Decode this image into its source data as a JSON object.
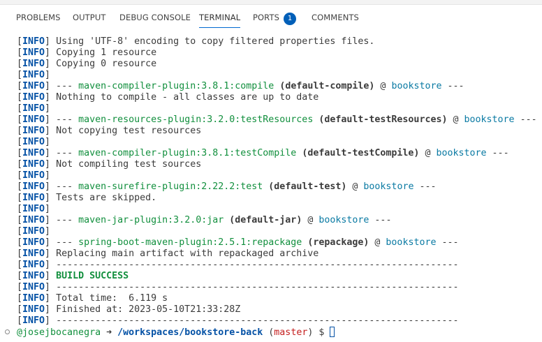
{
  "tabs": [
    {
      "label": "PROBLEMS",
      "active": false
    },
    {
      "label": "OUTPUT",
      "active": false
    },
    {
      "label": "DEBUG CONSOLE",
      "active": false
    },
    {
      "label": "TERMINAL",
      "active": true
    },
    {
      "label": "PORTS",
      "active": false
    },
    {
      "label": "COMMENTS",
      "active": false
    }
  ],
  "ports_badge": "1",
  "terminal": {
    "info_tag": "INFO",
    "messages": {
      "encoding": "Using 'UTF-8' encoding to copy filtered properties files.",
      "copy1": "Copying 1 resource",
      "copy0": "Copying 0 resource",
      "nothing_compile": "Nothing to compile - all classes are up to date",
      "not_copying": "Not copying test resources",
      "not_compiling": "Not compiling test sources",
      "tests_skipped": "Tests are skipped.",
      "replacing": "Replacing main artifact with repackaged archive",
      "separator": "------------------------------------------------------------------------",
      "build_success": "BUILD SUCCESS",
      "total_time": "Total time:  6.119 s",
      "finished_at": "Finished at: 2023-05-10T21:33:28Z"
    },
    "plugin_runs": [
      {
        "plugin": "maven-compiler-plugin:3.8.1:compile",
        "goal": "(default-compile)",
        "project": "bookstore"
      },
      {
        "plugin": "maven-resources-plugin:3.2.0:testResources",
        "goal": "(default-testResources)",
        "project": "bookstore"
      },
      {
        "plugin": "maven-compiler-plugin:3.8.1:testCompile",
        "goal": "(default-testCompile)",
        "project": "bookstore"
      },
      {
        "plugin": "maven-surefire-plugin:2.22.2:test",
        "goal": "(default-test)",
        "project": "bookstore"
      },
      {
        "plugin": "maven-jar-plugin:3.2.0:jar",
        "goal": "(default-jar)",
        "project": "bookstore"
      },
      {
        "plugin": "spring-boot-maven-plugin:2.5.1:repackage",
        "goal": "(repackage)",
        "project": "bookstore"
      }
    ],
    "prompt": {
      "user": "@josejbocanegra",
      "arrow": "➜",
      "path": "/workspaces/bookstore-back",
      "branch": "master",
      "symbol": "$"
    }
  }
}
